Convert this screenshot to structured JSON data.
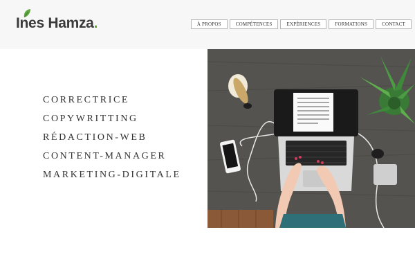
{
  "brand": {
    "name": "Ines Hamza",
    "dot": ".",
    "accent_color": "#5aa63b"
  },
  "nav": {
    "items": [
      {
        "label": "À PROPOS"
      },
      {
        "label": "COMPÉTENCES"
      },
      {
        "label": "EXPÉRIENCES"
      },
      {
        "label": "FORMATIONS"
      },
      {
        "label": "CONTACT"
      }
    ]
  },
  "skills": [
    "CORRECTRICE",
    "COPYWRITTING",
    "RÉDACTION-WEB",
    "CONTENT-MANAGER",
    "MARKETING-DIGITALE"
  ],
  "hero": {
    "icon": "laptop-workspace-photo"
  }
}
